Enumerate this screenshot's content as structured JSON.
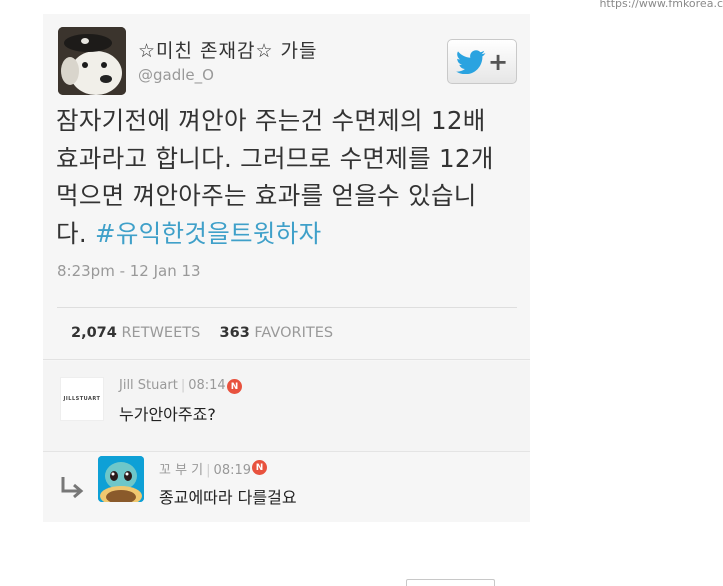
{
  "watermark": "https://www.fmkorea.c",
  "tweet": {
    "display_name": "☆미친 존재감☆ 가들",
    "handle": "@gadle_O",
    "text_lines": [
      "잠자기전에 껴안아 주는건 수면제의 12배",
      "효과라고 합니다. 그러므로 수면제를 12개",
      "먹으면 껴안아주는 효과를 얻을수 있습니",
      "다. "
    ],
    "hashtag": "#유익한것을트윗하자",
    "timestamp": "8:23pm - 12 Jan 13",
    "retweets_count": "2,074",
    "retweets_label": "RETWEETS",
    "favorites_count": "363",
    "favorites_label": "FAVORITES",
    "follow_button": {
      "icon": "twitter-bird-icon",
      "plus": "+"
    }
  },
  "replies": [
    {
      "name": "Jill Stuart",
      "time": "08:14",
      "badge": "N",
      "text": "누가안아주죠?",
      "avatar_text": "JILLSTUART"
    },
    {
      "name": "꼬 부 기",
      "time": "08:19",
      "badge": "N",
      "text": "종교에따라 다를걸요",
      "icon": "reply-arrow-icon"
    }
  ],
  "colors": {
    "hashtag": "#3fa0c9",
    "twitter_blue": "#2aa3e0",
    "badge": "#e8523e",
    "muted": "#999999"
  }
}
